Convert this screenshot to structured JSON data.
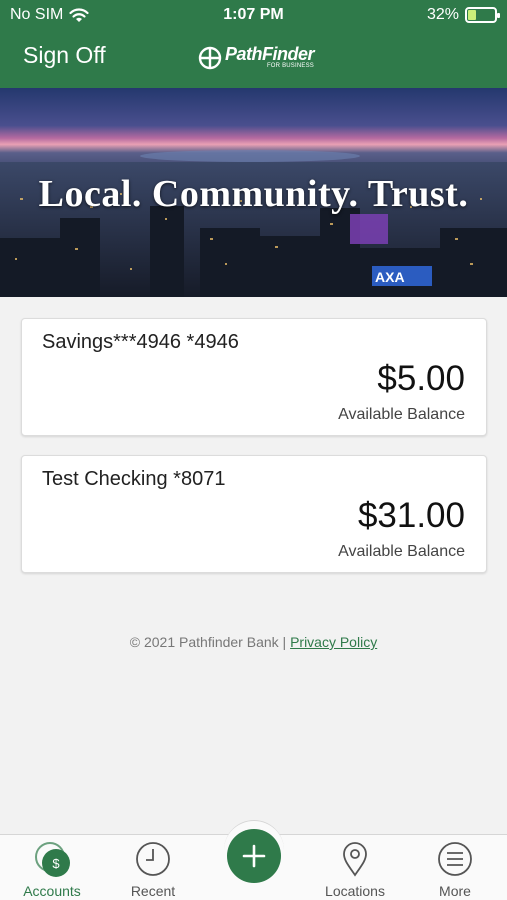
{
  "status_bar": {
    "carrier": "No SIM",
    "time": "1:07 PM",
    "battery_percent": "32%",
    "battery_level": 0.32,
    "battery_fill_color": "#c9f07a",
    "wifi_icon": "wifi-icon",
    "battery_icon": "battery-charging-icon"
  },
  "header": {
    "sign_off": "Sign Off",
    "logo_text": "PathFinder",
    "logo_subtext": "FOR BUSINESS",
    "background_color": "#2f7a4a"
  },
  "hero": {
    "tagline": "Local. Community. Trust."
  },
  "accounts": [
    {
      "name": "Savings***4946 *4946",
      "balance": "$5.00",
      "balance_label": "Available Balance"
    },
    {
      "name": "Test Checking *8071",
      "balance": "$31.00",
      "balance_label": "Available Balance"
    }
  ],
  "footer": {
    "copyright": "© 2021 Pathfinder Bank |",
    "privacy_link": "Privacy Policy"
  },
  "tabbar": {
    "active_color": "#2f7a4a",
    "tabs": [
      {
        "label": "Accounts",
        "icon": "dollar-coin-icon",
        "active": true
      },
      {
        "label": "Recent",
        "icon": "clock-icon",
        "active": false
      },
      {
        "label": "",
        "icon": "plus-icon",
        "active": false
      },
      {
        "label": "Locations",
        "icon": "map-pin-icon",
        "active": false
      },
      {
        "label": "More",
        "icon": "menu-icon",
        "active": false
      }
    ]
  }
}
